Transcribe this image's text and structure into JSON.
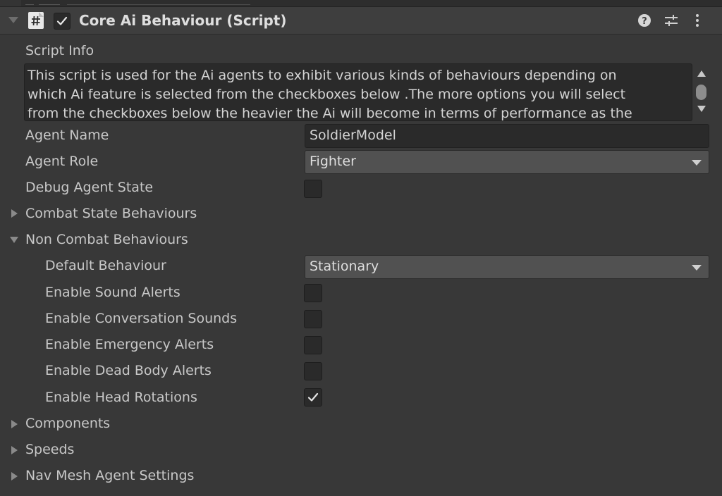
{
  "component": {
    "title": "Core Ai Behaviour (Script)",
    "enabled": true,
    "icons": [
      "script-hash-icon",
      "help-icon",
      "presets-icon",
      "kebab-menu-icon"
    ]
  },
  "script_info": {
    "label": "Script Info",
    "lines": [
      "This script is used for the Ai agents to exhibit various kinds of behaviours depending on",
      "which Ai feature is selected from the checkboxes below .The more options you will select",
      "from the checkboxes below the heavier the Ai will become in terms of performance as the"
    ]
  },
  "fields": {
    "agent_name": {
      "label": "Agent Name",
      "value": "SoldierModel"
    },
    "agent_role": {
      "label": "Agent Role",
      "value": "Fighter"
    },
    "debug_agent_state": {
      "label": "Debug Agent State",
      "checked": false
    }
  },
  "foldouts": {
    "combat": {
      "label": "Combat State Behaviours",
      "expanded": false
    },
    "non_combat": {
      "label": "Non Combat Behaviours",
      "expanded": true
    },
    "components": {
      "label": "Components",
      "expanded": false
    },
    "speeds": {
      "label": "Speeds",
      "expanded": false
    },
    "nav_mesh": {
      "label": "Nav Mesh Agent Settings",
      "expanded": false
    }
  },
  "non_combat": {
    "default_behaviour": {
      "label": "Default Behaviour",
      "value": "Stationary"
    },
    "sound_alerts": {
      "label": "Enable Sound Alerts",
      "checked": false
    },
    "conversation_sounds": {
      "label": "Enable Conversation Sounds",
      "checked": false
    },
    "emergency_alerts": {
      "label": "Enable Emergency Alerts",
      "checked": false
    },
    "dead_body_alerts": {
      "label": "Enable Dead Body Alerts",
      "checked": false
    },
    "head_rotations": {
      "label": "Enable Head Rotations",
      "checked": true
    }
  },
  "colors": {
    "panel_bg": "#383838",
    "header_bg": "#3e3e3e",
    "field_bg": "#2a2a2a",
    "dropdown_bg": "#515151",
    "text": "#d2d2d2"
  }
}
